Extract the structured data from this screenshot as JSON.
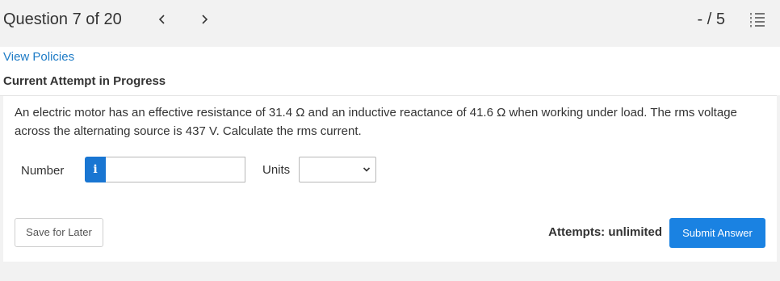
{
  "header": {
    "question_label": "Question 7 of 20",
    "prev_arrow": "‹",
    "next_arrow": "›",
    "score": "- / 5",
    "list_icon": "question-list-icon"
  },
  "meta": {
    "policies_link": "View Policies",
    "attempt_heading": "Current Attempt in Progress"
  },
  "question": {
    "text": "An electric motor has an effective resistance of 31.4 Ω and an inductive reactance of 41.6 Ω when working under load. The rms voltage across the alternating source is 437 V. Calculate the rms current."
  },
  "answer": {
    "number_label": "Number",
    "info_icon": "i",
    "number_value": "",
    "units_label": "Units",
    "units_selected": ""
  },
  "footer": {
    "save_label": "Save for Later",
    "attempts_text": "Attempts: unlimited",
    "submit_label": "Submit Answer"
  },
  "colors": {
    "accent": "#1a82e2",
    "link": "#1d7bc6",
    "background": "#f2f2f2"
  }
}
